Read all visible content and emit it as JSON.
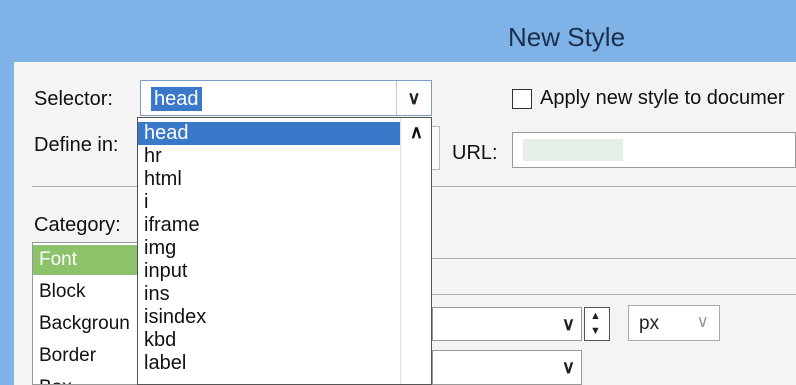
{
  "window": {
    "title": "New Style"
  },
  "form": {
    "selector_label": "Selector:",
    "selector_value": "head",
    "apply_label": "Apply new style to documer",
    "define_label": "Define in:",
    "url_label": "URL:",
    "category_label": "Category:"
  },
  "category": {
    "items": [
      {
        "label": "Font",
        "selected": true
      },
      {
        "label": "Block",
        "selected": false
      },
      {
        "label": "Backgroun",
        "selected": false
      },
      {
        "label": "Border",
        "selected": false
      },
      {
        "label": "Box",
        "selected": false
      }
    ]
  },
  "dropdown": {
    "items": [
      {
        "label": "head",
        "selected": true
      },
      {
        "label": "hr",
        "selected": false
      },
      {
        "label": "html",
        "selected": false
      },
      {
        "label": "i",
        "selected": false
      },
      {
        "label": "iframe",
        "selected": false
      },
      {
        "label": "img",
        "selected": false
      },
      {
        "label": "input",
        "selected": false
      },
      {
        "label": "ins",
        "selected": false
      },
      {
        "label": "isindex",
        "selected": false
      },
      {
        "label": "kbd",
        "selected": false
      },
      {
        "label": "label",
        "selected": false
      }
    ]
  },
  "font": {
    "size_unit": "px"
  },
  "icons": {
    "combo_caret": "chevron-down-icon",
    "scroll_up": "chevron-up-icon",
    "spin_up": "triangle-up-icon",
    "spin_down": "triangle-down-icon"
  },
  "colors": {
    "titlebar": "#7fb2e6",
    "selection_blue": "#3a78c9",
    "category_selection": "#8bc26a"
  }
}
